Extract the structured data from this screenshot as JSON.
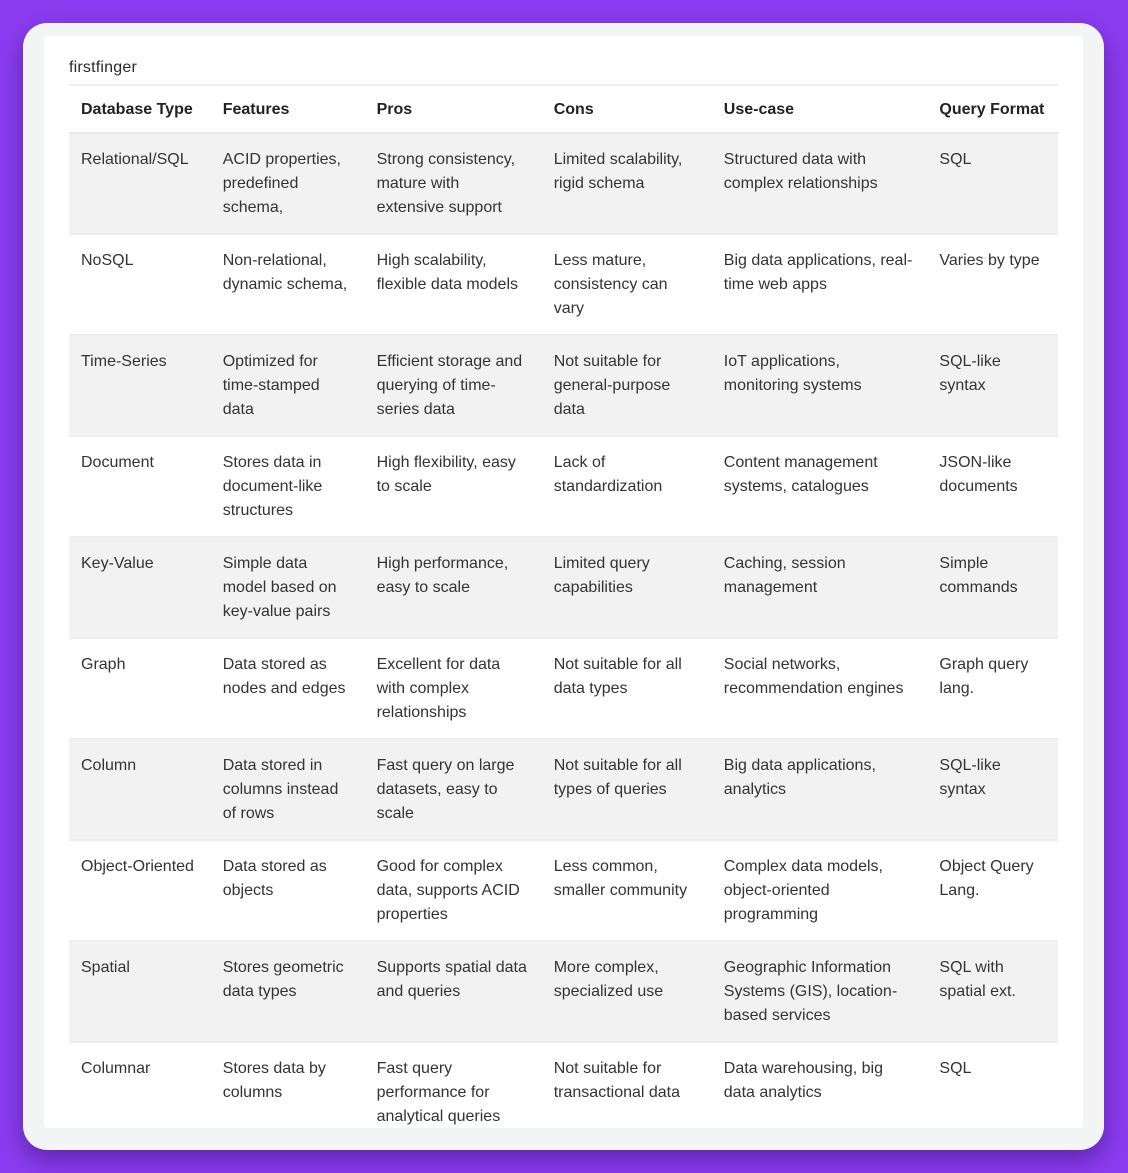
{
  "page": {
    "title": "firstfinger",
    "colors": {
      "background": "#8b3cf0",
      "frame": "#f3f4f4",
      "panel": "#ffffff",
      "stripe": "#f2f2f2"
    }
  },
  "table": {
    "headers": [
      "Database Type",
      "Features",
      "Pros",
      "Cons",
      "Use-case",
      "Query Format"
    ],
    "rows": [
      [
        "Relational/SQL",
        "ACID properties, predefined schema,",
        "Strong consistency, mature with extensive support",
        "Limited scalability, rigid schema",
        "Structured data with complex relationships",
        "SQL"
      ],
      [
        "NoSQL",
        "Non-relational, dynamic schema,",
        "High scalability, flexible data models",
        "Less mature, consistency can vary",
        "Big data applications, real-time web apps",
        "Varies by type"
      ],
      [
        "Time-Series",
        "Optimized for time-stamped data",
        "Efficient storage and querying of time-series data",
        "Not suitable for general-purpose data",
        "IoT applications, monitoring systems",
        "SQL-like syntax"
      ],
      [
        "Document",
        "Stores data in document-like structures",
        "High flexibility, easy to scale",
        "Lack of standardization",
        "Content management systems, catalogues",
        "JSON-like documents"
      ],
      [
        "Key-Value",
        "Simple data model based on key-value pairs",
        "High performance, easy to scale",
        "Limited query capabilities",
        "Caching, session management",
        "Simple commands"
      ],
      [
        "Graph",
        "Data stored as nodes and edges",
        "Excellent for data with complex relationships",
        "Not suitable for all data types",
        "Social networks, recommendation engines",
        "Graph query lang."
      ],
      [
        "Column",
        "Data stored in columns instead of rows",
        "Fast query on large datasets, easy to scale",
        "Not suitable for all types of queries",
        "Big data applications, analytics",
        "SQL-like syntax"
      ],
      [
        "Object-Oriented",
        "Data stored as objects",
        "Good for complex data, supports ACID properties",
        "Less common, smaller community",
        "Complex data models, object-oriented programming",
        "Object Query Lang."
      ],
      [
        "Spatial",
        "Stores geometric data types",
        "Supports spatial data and queries",
        "More complex, specialized use",
        "Geographic Information Systems (GIS), location-based services",
        "SQL with spatial ext."
      ],
      [
        "Columnar",
        "Stores data by columns",
        "Fast query performance for analytical queries",
        "Not suitable for transactional data",
        "Data warehousing, big data analytics",
        "SQL"
      ]
    ]
  }
}
